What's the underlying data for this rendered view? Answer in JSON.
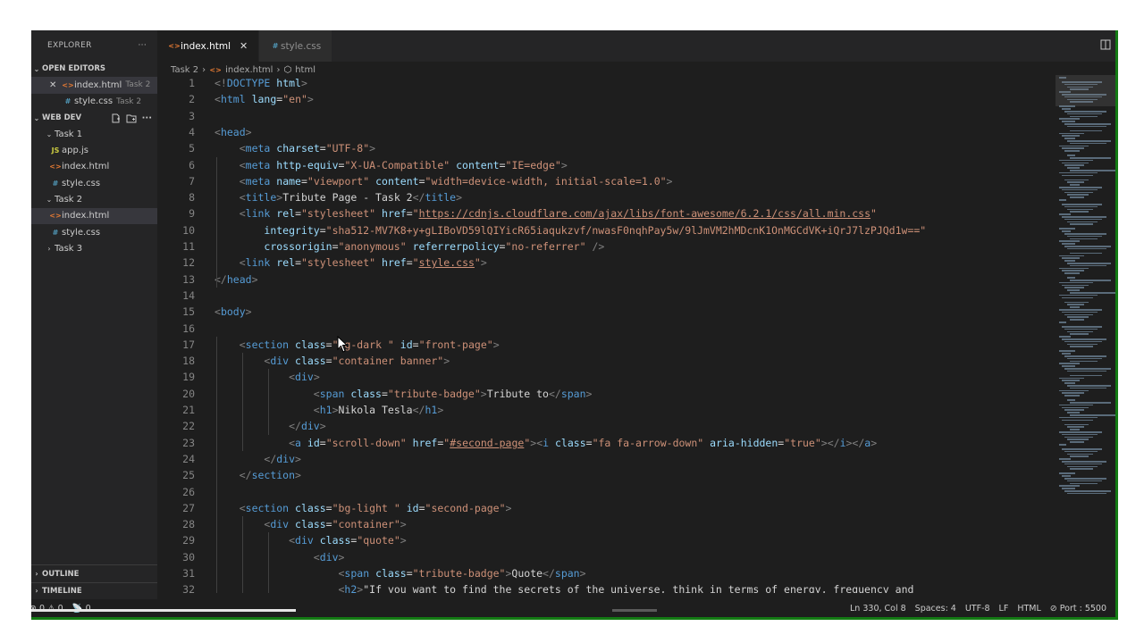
{
  "sidebar": {
    "title": "EXPLORER",
    "more": "···",
    "open_editors": "OPEN EDITORS",
    "open_files": [
      {
        "name": "index.html",
        "folder": "Task 2",
        "icon": "<>",
        "type": "html"
      },
      {
        "name": "style.css",
        "folder": "Task 2",
        "icon": "#",
        "type": "css"
      }
    ],
    "workspace": "WEB DEV",
    "tree": [
      {
        "label": "Task 1",
        "kind": "folder",
        "open": true
      },
      {
        "label": "app.js",
        "kind": "js",
        "icon": "JS"
      },
      {
        "label": "index.html",
        "kind": "html",
        "icon": "<>"
      },
      {
        "label": "style.css",
        "kind": "css",
        "icon": "#"
      },
      {
        "label": "Task 2",
        "kind": "folder",
        "open": true
      },
      {
        "label": "index.html",
        "kind": "html",
        "icon": "<>",
        "selected": true
      },
      {
        "label": "style.css",
        "kind": "css",
        "icon": "#"
      },
      {
        "label": "Task 3",
        "kind": "folder",
        "open": false
      }
    ],
    "outline": "OUTLINE",
    "timeline": "TIMELINE"
  },
  "tabs": [
    {
      "label": "index.html",
      "icon": "<>",
      "active": true
    },
    {
      "label": "style.css",
      "icon": "#",
      "active": false
    }
  ],
  "breadcrumb": [
    "Task 2",
    "index.html",
    "html"
  ],
  "code_lines": [
    {
      "n": "1",
      "t": [
        [
          "p",
          "<!"
        ],
        [
          "g",
          "DOCTYPE"
        ],
        [
          "x",
          " "
        ],
        [
          "a",
          "html"
        ],
        [
          "p",
          ">"
        ]
      ]
    },
    {
      "n": "2",
      "t": [
        [
          "p",
          "<"
        ],
        [
          "g",
          "html"
        ],
        [
          "x",
          " "
        ],
        [
          "a",
          "lang"
        ],
        [
          "x",
          "="
        ],
        [
          "s",
          "\"en\""
        ],
        [
          "p",
          ">"
        ]
      ]
    },
    {
      "n": "3",
      "t": []
    },
    {
      "n": "4",
      "t": [
        [
          "p",
          "<"
        ],
        [
          "g",
          "head"
        ],
        [
          "p",
          ">"
        ]
      ]
    },
    {
      "n": "5",
      "t": [
        [
          "x",
          "    "
        ],
        [
          "p",
          "<"
        ],
        [
          "g",
          "meta"
        ],
        [
          "x",
          " "
        ],
        [
          "a",
          "charset"
        ],
        [
          "x",
          "="
        ],
        [
          "s",
          "\"UTF-8\""
        ],
        [
          "p",
          ">"
        ]
      ]
    },
    {
      "n": "6",
      "t": [
        [
          "x",
          "    "
        ],
        [
          "p",
          "<"
        ],
        [
          "g",
          "meta"
        ],
        [
          "x",
          " "
        ],
        [
          "a",
          "http-equiv"
        ],
        [
          "x",
          "="
        ],
        [
          "s",
          "\"X-UA-Compatible\""
        ],
        [
          "x",
          " "
        ],
        [
          "a",
          "content"
        ],
        [
          "x",
          "="
        ],
        [
          "s",
          "\"IE=edge\""
        ],
        [
          "p",
          ">"
        ]
      ]
    },
    {
      "n": "7",
      "t": [
        [
          "x",
          "    "
        ],
        [
          "p",
          "<"
        ],
        [
          "g",
          "meta"
        ],
        [
          "x",
          " "
        ],
        [
          "a",
          "name"
        ],
        [
          "x",
          "="
        ],
        [
          "s",
          "\"viewport\""
        ],
        [
          "x",
          " "
        ],
        [
          "a",
          "content"
        ],
        [
          "x",
          "="
        ],
        [
          "s",
          "\"width=device-width, initial-scale=1.0\""
        ],
        [
          "p",
          ">"
        ]
      ]
    },
    {
      "n": "8",
      "t": [
        [
          "x",
          "    "
        ],
        [
          "p",
          "<"
        ],
        [
          "g",
          "title"
        ],
        [
          "p",
          ">"
        ],
        [
          "x",
          "Tribute Page - Task 2"
        ],
        [
          "p",
          "</"
        ],
        [
          "g",
          "title"
        ],
        [
          "p",
          ">"
        ]
      ]
    },
    {
      "n": "9",
      "t": [
        [
          "x",
          "    "
        ],
        [
          "p",
          "<"
        ],
        [
          "g",
          "link"
        ],
        [
          "x",
          " "
        ],
        [
          "a",
          "rel"
        ],
        [
          "x",
          "="
        ],
        [
          "s",
          "\"stylesheet\""
        ],
        [
          "x",
          " "
        ],
        [
          "a",
          "href"
        ],
        [
          "x",
          "="
        ],
        [
          "s",
          "\""
        ],
        [
          "u",
          "https://cdnjs.cloudflare.com/ajax/libs/font-awesome/6.2.1/css/all.min.css"
        ],
        [
          "s",
          "\""
        ]
      ]
    },
    {
      "n": "10",
      "t": [
        [
          "x",
          "        "
        ],
        [
          "a",
          "integrity"
        ],
        [
          "x",
          "="
        ],
        [
          "s",
          "\"sha512-MV7K8+y+gLIBoVD59lQIYicR65iaqukzvf/nwasF0nqhPay5w/9lJmVM2hMDcnK1OnMGCdVK+iQrJ7lzPJQd1w==\""
        ]
      ]
    },
    {
      "n": "11",
      "t": [
        [
          "x",
          "        "
        ],
        [
          "a",
          "crossorigin"
        ],
        [
          "x",
          "="
        ],
        [
          "s",
          "\"anonymous\""
        ],
        [
          "x",
          " "
        ],
        [
          "a",
          "referrerpolicy"
        ],
        [
          "x",
          "="
        ],
        [
          "s",
          "\"no-referrer\""
        ],
        [
          "x",
          " "
        ],
        [
          "p",
          "/>"
        ]
      ]
    },
    {
      "n": "12",
      "t": [
        [
          "x",
          "    "
        ],
        [
          "p",
          "<"
        ],
        [
          "g",
          "link"
        ],
        [
          "x",
          " "
        ],
        [
          "a",
          "rel"
        ],
        [
          "x",
          "="
        ],
        [
          "s",
          "\"stylesheet\""
        ],
        [
          "x",
          " "
        ],
        [
          "a",
          "href"
        ],
        [
          "x",
          "="
        ],
        [
          "s",
          "\""
        ],
        [
          "u",
          "style.css"
        ],
        [
          "s",
          "\""
        ],
        [
          "p",
          ">"
        ]
      ]
    },
    {
      "n": "13",
      "t": [
        [
          "p",
          "</"
        ],
        [
          "g",
          "head"
        ],
        [
          "p",
          ">"
        ]
      ]
    },
    {
      "n": "14",
      "t": []
    },
    {
      "n": "15",
      "t": [
        [
          "p",
          "<"
        ],
        [
          "g",
          "body"
        ],
        [
          "p",
          ">"
        ]
      ]
    },
    {
      "n": "16",
      "t": []
    },
    {
      "n": "17",
      "t": [
        [
          "x",
          "    "
        ],
        [
          "p",
          "<"
        ],
        [
          "g",
          "section"
        ],
        [
          "x",
          " "
        ],
        [
          "a",
          "class"
        ],
        [
          "x",
          "="
        ],
        [
          "s",
          "\"bg-dark \""
        ],
        [
          "x",
          " "
        ],
        [
          "a",
          "id"
        ],
        [
          "x",
          "="
        ],
        [
          "s",
          "\"front-page\""
        ],
        [
          "p",
          ">"
        ]
      ]
    },
    {
      "n": "18",
      "t": [
        [
          "x",
          "        "
        ],
        [
          "p",
          "<"
        ],
        [
          "g",
          "div"
        ],
        [
          "x",
          " "
        ],
        [
          "a",
          "class"
        ],
        [
          "x",
          "="
        ],
        [
          "s",
          "\"container banner\""
        ],
        [
          "p",
          ">"
        ]
      ]
    },
    {
      "n": "19",
      "t": [
        [
          "x",
          "            "
        ],
        [
          "p",
          "<"
        ],
        [
          "g",
          "div"
        ],
        [
          "p",
          ">"
        ]
      ]
    },
    {
      "n": "20",
      "t": [
        [
          "x",
          "                "
        ],
        [
          "p",
          "<"
        ],
        [
          "g",
          "span"
        ],
        [
          "x",
          " "
        ],
        [
          "a",
          "class"
        ],
        [
          "x",
          "="
        ],
        [
          "s",
          "\"tribute-badge\""
        ],
        [
          "p",
          ">"
        ],
        [
          "x",
          "Tribute to"
        ],
        [
          "p",
          "</"
        ],
        [
          "g",
          "span"
        ],
        [
          "p",
          ">"
        ]
      ]
    },
    {
      "n": "21",
      "t": [
        [
          "x",
          "                "
        ],
        [
          "p",
          "<"
        ],
        [
          "g",
          "h1"
        ],
        [
          "p",
          ">"
        ],
        [
          "x",
          "Nikola Tesla"
        ],
        [
          "p",
          "</"
        ],
        [
          "g",
          "h1"
        ],
        [
          "p",
          ">"
        ]
      ]
    },
    {
      "n": "22",
      "t": [
        [
          "x",
          "            "
        ],
        [
          "p",
          "</"
        ],
        [
          "g",
          "div"
        ],
        [
          "p",
          ">"
        ]
      ]
    },
    {
      "n": "23",
      "t": [
        [
          "x",
          "            "
        ],
        [
          "p",
          "<"
        ],
        [
          "g",
          "a"
        ],
        [
          "x",
          " "
        ],
        [
          "a",
          "id"
        ],
        [
          "x",
          "="
        ],
        [
          "s",
          "\"scroll-down\""
        ],
        [
          "x",
          " "
        ],
        [
          "a",
          "href"
        ],
        [
          "x",
          "="
        ],
        [
          "s",
          "\""
        ],
        [
          "u",
          "#second-page"
        ],
        [
          "s",
          "\""
        ],
        [
          "p",
          "><"
        ],
        [
          "g",
          "i"
        ],
        [
          "x",
          " "
        ],
        [
          "a",
          "class"
        ],
        [
          "x",
          "="
        ],
        [
          "s",
          "\"fa fa-arrow-down\""
        ],
        [
          "x",
          " "
        ],
        [
          "a",
          "aria-hidden"
        ],
        [
          "x",
          "="
        ],
        [
          "s",
          "\"true\""
        ],
        [
          "p",
          "></"
        ],
        [
          "g",
          "i"
        ],
        [
          "p",
          "></"
        ],
        [
          "g",
          "a"
        ],
        [
          "p",
          ">"
        ]
      ]
    },
    {
      "n": "24",
      "t": [
        [
          "x",
          "        "
        ],
        [
          "p",
          "</"
        ],
        [
          "g",
          "div"
        ],
        [
          "p",
          ">"
        ]
      ]
    },
    {
      "n": "25",
      "t": [
        [
          "x",
          "    "
        ],
        [
          "p",
          "</"
        ],
        [
          "g",
          "section"
        ],
        [
          "p",
          ">"
        ]
      ]
    },
    {
      "n": "26",
      "t": []
    },
    {
      "n": "27",
      "t": [
        [
          "x",
          "    "
        ],
        [
          "p",
          "<"
        ],
        [
          "g",
          "section"
        ],
        [
          "x",
          " "
        ],
        [
          "a",
          "class"
        ],
        [
          "x",
          "="
        ],
        [
          "s",
          "\"bg-light \""
        ],
        [
          "x",
          " "
        ],
        [
          "a",
          "id"
        ],
        [
          "x",
          "="
        ],
        [
          "s",
          "\"second-page\""
        ],
        [
          "p",
          ">"
        ]
      ]
    },
    {
      "n": "28",
      "t": [
        [
          "x",
          "        "
        ],
        [
          "p",
          "<"
        ],
        [
          "g",
          "div"
        ],
        [
          "x",
          " "
        ],
        [
          "a",
          "class"
        ],
        [
          "x",
          "="
        ],
        [
          "s",
          "\"container\""
        ],
        [
          "p",
          ">"
        ]
      ]
    },
    {
      "n": "29",
      "t": [
        [
          "x",
          "            "
        ],
        [
          "p",
          "<"
        ],
        [
          "g",
          "div"
        ],
        [
          "x",
          " "
        ],
        [
          "a",
          "class"
        ],
        [
          "x",
          "="
        ],
        [
          "s",
          "\"quote\""
        ],
        [
          "p",
          ">"
        ]
      ]
    },
    {
      "n": "30",
      "t": [
        [
          "x",
          "                "
        ],
        [
          "p",
          "<"
        ],
        [
          "g",
          "div"
        ],
        [
          "p",
          ">"
        ]
      ]
    },
    {
      "n": "31",
      "t": [
        [
          "x",
          "                    "
        ],
        [
          "p",
          "<"
        ],
        [
          "g",
          "span"
        ],
        [
          "x",
          " "
        ],
        [
          "a",
          "class"
        ],
        [
          "x",
          "="
        ],
        [
          "s",
          "\"tribute-badge\""
        ],
        [
          "p",
          ">"
        ],
        [
          "x",
          "Quote"
        ],
        [
          "p",
          "</"
        ],
        [
          "g",
          "span"
        ],
        [
          "p",
          ">"
        ]
      ]
    },
    {
      "n": "32",
      "t": [
        [
          "x",
          "                    "
        ],
        [
          "p",
          "<"
        ],
        [
          "g",
          "h2"
        ],
        [
          "p",
          ">"
        ],
        [
          "x",
          "\"If you want to find the secrets of the universe, think in terms of energy, frequency and"
        ]
      ]
    }
  ],
  "status": {
    "errors": "0",
    "warnings": "0",
    "ports": "0",
    "position": "Ln 330, Col 8",
    "spaces": "Spaces: 4",
    "encoding": "UTF-8",
    "eol": "LF",
    "language": "HTML",
    "port": "Port : 5500"
  },
  "colors": {
    "editor_bg": "#1e1e1e",
    "sidebar_bg": "#252526",
    "tag": "#569cd6",
    "attr": "#9cdcfe",
    "string": "#ce9178",
    "window_border": "#137a13"
  },
  "icons": {
    "split_editor": "split-editor-icon",
    "new_file": "new-file-icon",
    "new_folder": "new-folder-icon",
    "close": "close-icon",
    "error": "error-icon",
    "warning": "warning-icon",
    "broadcast": "broadcast-icon",
    "port": "port-icon"
  }
}
